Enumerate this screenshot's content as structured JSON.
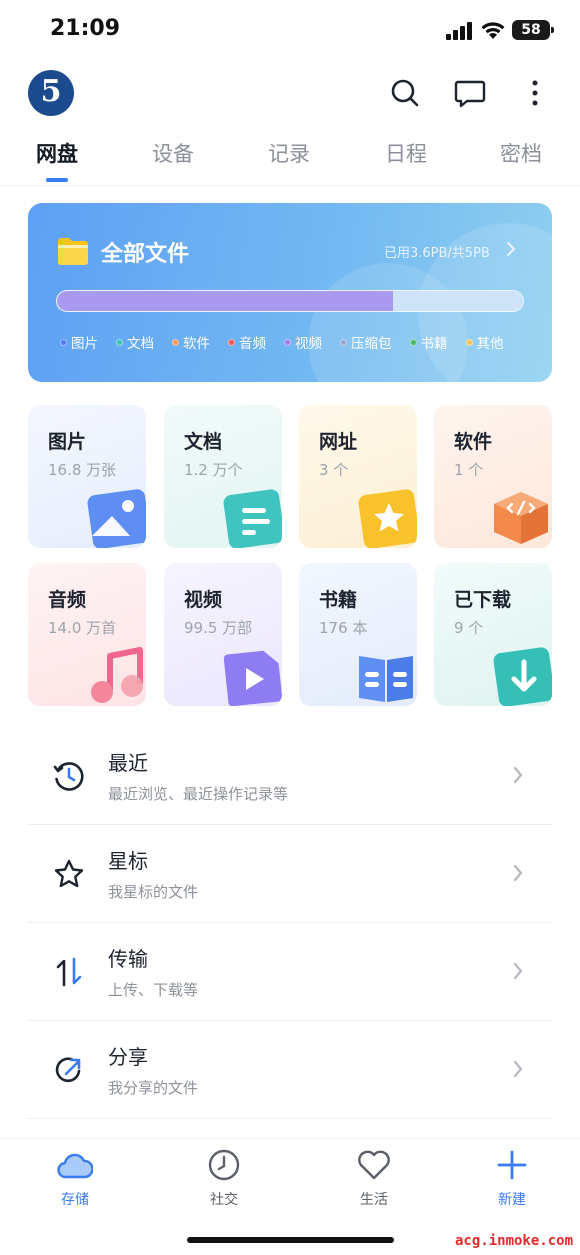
{
  "status_bar": {
    "time": "21:09",
    "battery": "58"
  },
  "header": {
    "logo_text": "5"
  },
  "tabs": [
    {
      "label": "网盘",
      "active": true
    },
    {
      "label": "设备"
    },
    {
      "label": "记录"
    },
    {
      "label": "日程"
    },
    {
      "label": "密档"
    }
  ],
  "storage": {
    "title": "全部文件",
    "used_text": "已用3.6PB/共5PB",
    "used_fraction": 0.72,
    "legend": [
      {
        "label": "图片",
        "color": "#4f7cf0"
      },
      {
        "label": "文档",
        "color": "#38c2b4"
      },
      {
        "label": "软件",
        "color": "#f2995c"
      },
      {
        "label": "音频",
        "color": "#ef5a5a"
      },
      {
        "label": "视频",
        "color": "#a37cf2"
      },
      {
        "label": "压缩包",
        "color": "#9aa6d8"
      },
      {
        "label": "书籍",
        "color": "#4cb86a"
      },
      {
        "label": "其他",
        "color": "#f5c451"
      }
    ]
  },
  "categories": [
    {
      "name": "图片",
      "count": "16.8 万张"
    },
    {
      "name": "文档",
      "count": "1.2 万个"
    },
    {
      "name": "网址",
      "count": "3 个"
    },
    {
      "name": "软件",
      "count": "1 个"
    },
    {
      "name": "音频",
      "count": "14.0 万首"
    },
    {
      "name": "视频",
      "count": "99.5 万部"
    },
    {
      "name": "书籍",
      "count": "176 本"
    },
    {
      "name": "已下载",
      "count": "9 个"
    }
  ],
  "list": [
    {
      "title": "最近",
      "subtitle": "最近浏览、最近操作记录等"
    },
    {
      "title": "星标",
      "subtitle": "我星标的文件"
    },
    {
      "title": "传输",
      "subtitle": "上传、下载等"
    },
    {
      "title": "分享",
      "subtitle": "我分享的文件"
    }
  ],
  "bottom_nav": [
    {
      "label": "存储",
      "active": true
    },
    {
      "label": "社交"
    },
    {
      "label": "生活"
    },
    {
      "label": "新建"
    }
  ],
  "watermark": "acg.inmoke.com",
  "colors": {
    "accent": "#3a7bf0"
  }
}
